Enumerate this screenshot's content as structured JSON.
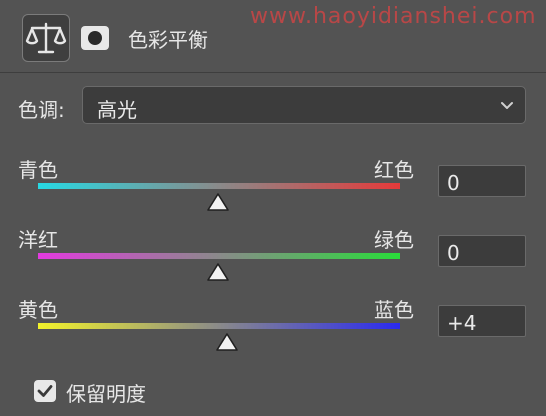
{
  "header": {
    "title": "色彩平衡",
    "watermark": "www.haoyidianshei.com",
    "icons": [
      "balance-scale-icon",
      "layer-mask-icon"
    ]
  },
  "tone": {
    "label": "色调:",
    "value": "高光"
  },
  "sliders": [
    {
      "left": "青色",
      "right": "红色",
      "value": "0"
    },
    {
      "left": "洋红",
      "right": "绿色",
      "value": "0"
    },
    {
      "left": "黄色",
      "right": "蓝色",
      "value": "+4"
    }
  ],
  "preserve": {
    "label": "保留明度",
    "checked": true
  },
  "colors": {
    "cyan": "#27d9e3",
    "red": "#e53a3a",
    "magenta": "#e33ae0",
    "green": "#29dc3a",
    "yellow": "#f2f22a",
    "blue": "#2a2af0",
    "panel": "#535353",
    "field": "#3c3c3c"
  }
}
